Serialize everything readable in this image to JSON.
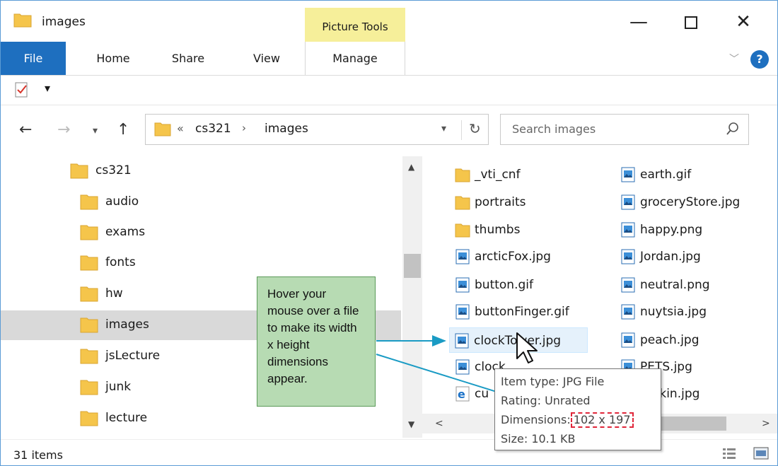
{
  "window": {
    "title": "images",
    "context_tab": "Picture Tools",
    "controls": {
      "minimize": "—",
      "close": "✕"
    }
  },
  "ribbon": {
    "tabs": [
      "File",
      "Home",
      "Share",
      "View",
      "Manage"
    ],
    "help_label": "?"
  },
  "address": {
    "prefix": "«",
    "segments": [
      "cs321",
      "images"
    ],
    "separator": "›"
  },
  "search": {
    "placeholder": "Search images"
  },
  "nav_tree": [
    {
      "label": "cs321",
      "selected": false
    },
    {
      "label": "audio",
      "selected": false
    },
    {
      "label": "exams",
      "selected": false
    },
    {
      "label": "fonts",
      "selected": false
    },
    {
      "label": "hw",
      "selected": false
    },
    {
      "label": "images",
      "selected": true
    },
    {
      "label": "jsLecture",
      "selected": false
    },
    {
      "label": "junk",
      "selected": false
    },
    {
      "label": "lecture",
      "selected": false
    }
  ],
  "files_col1": [
    {
      "label": "_vti_cnf",
      "icon": "folder-icon"
    },
    {
      "label": "portraits",
      "icon": "folder-icon"
    },
    {
      "label": "thumbs",
      "icon": "folder-icon"
    },
    {
      "label": "arcticFox.jpg",
      "icon": "image-file-icon"
    },
    {
      "label": "button.gif",
      "icon": "image-file-icon"
    },
    {
      "label": "buttonFinger.gif",
      "icon": "image-file-icon"
    },
    {
      "label": "clockTower.jpg",
      "icon": "image-file-icon"
    },
    {
      "label": "clock",
      "icon": "image-file-icon"
    },
    {
      "label": "cu",
      "icon": "ie-file-icon"
    }
  ],
  "files_col2": [
    {
      "label": "earth.gif",
      "icon": "image-file-icon"
    },
    {
      "label": "groceryStore.jpg",
      "icon": "image-file-icon"
    },
    {
      "label": "happy.png",
      "icon": "image-file-icon"
    },
    {
      "label": "Jordan.jpg",
      "icon": "image-file-icon"
    },
    {
      "label": "neutral.png",
      "icon": "image-file-icon"
    },
    {
      "label": "nuytsia.jpg",
      "icon": "image-file-icon"
    },
    {
      "label": "peach.jpg",
      "icon": "image-file-icon"
    },
    {
      "label": "PETS.jpg",
      "icon": "image-file-icon"
    },
    {
      "label": "mpkin.jpg",
      "icon": "image-file-icon"
    }
  ],
  "tooltip": {
    "item_type": "Item type: JPG File",
    "rating": "Rating: Unrated",
    "dimensions_label": "Dimensions:",
    "dimensions_value": "102 x 197",
    "size": "Size: 10.1 KB"
  },
  "callout": {
    "text": "Hover your mouse over a file to make its width x height dimensions appear."
  },
  "status": {
    "item_count": "31 items"
  },
  "colors": {
    "ribbon_file": "#1e6fbf",
    "context_tab": "#f6ef9a",
    "callout_fill": "#b7dbb3",
    "arrow": "#1a9bc4",
    "highlight_box": "#e0263a",
    "folder": "#f5c54b"
  }
}
